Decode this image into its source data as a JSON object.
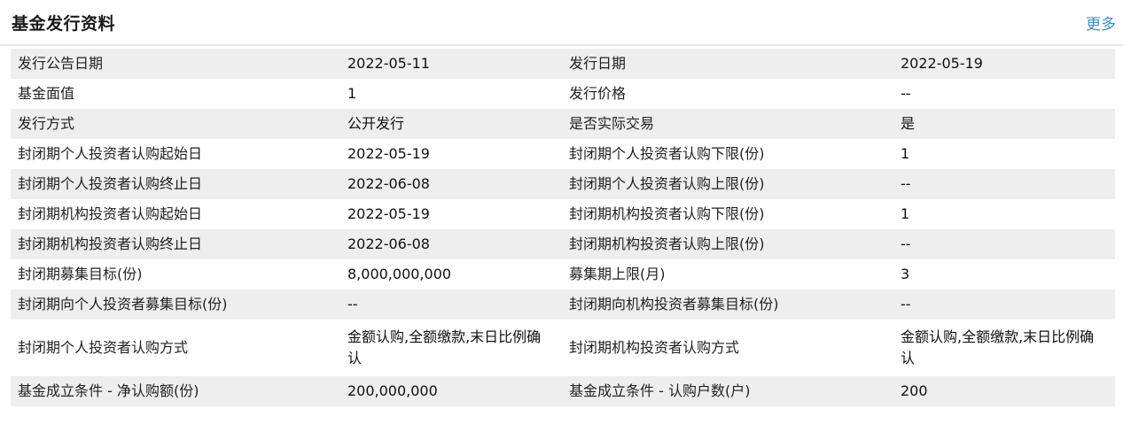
{
  "header": {
    "title": "基金发行资料",
    "more_label": "更多"
  },
  "rows": [
    {
      "l1": "发行公告日期",
      "v1": "2022-05-11",
      "l2": "发行日期",
      "v2": "2022-05-19"
    },
    {
      "l1": "基金面值",
      "v1": "1",
      "l2": "发行价格",
      "v2": "--"
    },
    {
      "l1": "发行方式",
      "v1": "公开发行",
      "l2": "是否实际交易",
      "v2": "是"
    },
    {
      "l1": "封闭期个人投资者认购起始日",
      "v1": "2022-05-19",
      "l2": "封闭期个人投资者认购下限(份)",
      "v2": "1"
    },
    {
      "l1": "封闭期个人投资者认购终止日",
      "v1": "2022-06-08",
      "l2": "封闭期个人投资者认购上限(份)",
      "v2": "--"
    },
    {
      "l1": "封闭期机构投资者认购起始日",
      "v1": "2022-05-19",
      "l2": "封闭期机构投资者认购下限(份)",
      "v2": "1"
    },
    {
      "l1": "封闭期机构投资者认购终止日",
      "v1": "2022-06-08",
      "l2": "封闭期机构投资者认购上限(份)",
      "v2": "--"
    },
    {
      "l1": "封闭期募集目标(份)",
      "v1": "8,000,000,000",
      "l2": "募集期上限(月)",
      "v2": "3"
    },
    {
      "l1": "封闭期向个人投资者募集目标(份)",
      "v1": "--",
      "l2": "封闭期向机构投资者募集目标(份)",
      "v2": "--"
    },
    {
      "l1": "封闭期个人投资者认购方式",
      "v1": "金额认购,全额缴款,末日比例确认",
      "l2": "封闭期机构投资者认购方式",
      "v2": "金额认购,全额缴款,末日比例确认"
    },
    {
      "l1": "基金成立条件 - 净认购额(份)",
      "v1": "200,000,000",
      "l2": "基金成立条件 - 认购户数(户)",
      "v2": "200"
    }
  ]
}
